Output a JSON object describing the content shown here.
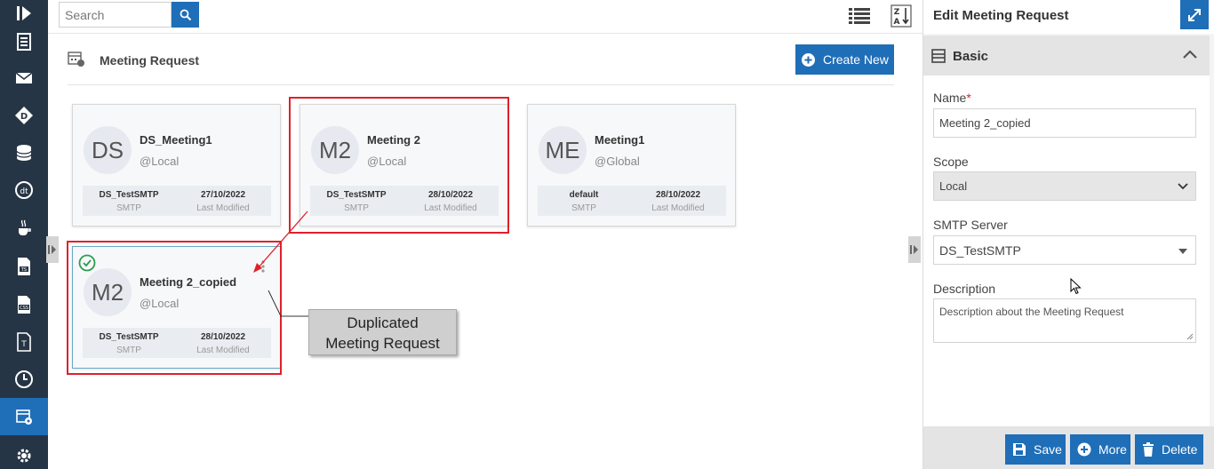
{
  "search": {
    "placeholder": "Search"
  },
  "section": {
    "title": "Meeting Request",
    "create_label": "Create New"
  },
  "cards": [
    {
      "initials": "DS",
      "name": "DS_Meeting1",
      "scope": "@Local",
      "server": "DS_TestSMTP",
      "server_label": "SMTP",
      "date": "27/10/2022",
      "date_label": "Last Modified"
    },
    {
      "initials": "M2",
      "name": "Meeting 2",
      "scope": "@Local",
      "server": "DS_TestSMTP",
      "server_label": "SMTP",
      "date": "28/10/2022",
      "date_label": "Last Modified"
    },
    {
      "initials": "ME",
      "name": "Meeting1",
      "scope": "@Global",
      "server": "default",
      "server_label": "SMTP",
      "date": "28/10/2022",
      "date_label": "Last Modified"
    },
    {
      "initials": "M2",
      "name": "Meeting 2_copied",
      "scope": "@Local",
      "server": "DS_TestSMTP",
      "server_label": "SMTP",
      "date": "28/10/2022",
      "date_label": "Last Modified",
      "selected": true
    }
  ],
  "callout": {
    "line1": "Duplicated",
    "line2": "Meeting Request"
  },
  "panel": {
    "title": "Edit Meeting Request",
    "section": "Basic",
    "name_label": "Name",
    "name_required": "*",
    "name_value": "Meeting 2_copied",
    "scope_label": "Scope",
    "scope_value": "Local",
    "smtp_label": "SMTP Server",
    "smtp_value": "DS_TestSMTP",
    "desc_label": "Description",
    "desc_value": "Description about the Meeting Request",
    "save_label": "Save",
    "more_label": "More",
    "delete_label": "Delete"
  },
  "colors": {
    "accent": "#1f6eb8",
    "rail": "#263545",
    "highlight": "#e0202a"
  }
}
